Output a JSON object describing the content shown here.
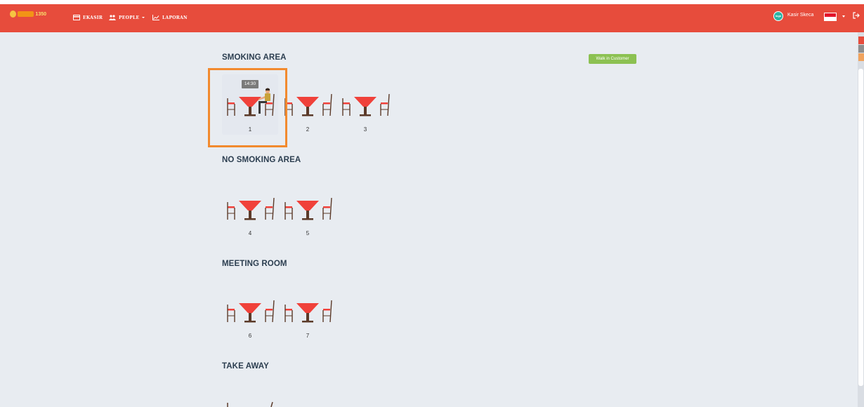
{
  "navbar": {
    "brand": "1350",
    "items": [
      {
        "label": "EKASIR",
        "icon": "credit-card-icon"
      },
      {
        "label": "PEOPLE",
        "icon": "people-icon"
      },
      {
        "label": "LAPORAN",
        "icon": "line-chart-icon"
      }
    ],
    "user": {
      "name": "Kasir Skeca",
      "avatar_text": "logo"
    }
  },
  "walkin_button": "Walk in Customer",
  "sections": [
    {
      "title": "SMOKING AREA"
    },
    {
      "title": "NO SMOKING AREA"
    },
    {
      "title": "MEETING ROOM"
    },
    {
      "title": "TAKE AWAY"
    }
  ],
  "tables": [
    {
      "number": "1",
      "occupied": true,
      "time": "14:30"
    },
    {
      "number": "2"
    },
    {
      "number": "3"
    },
    {
      "number": "4"
    },
    {
      "number": "5"
    },
    {
      "number": "6"
    },
    {
      "number": "7"
    }
  ],
  "colors": {
    "navbar": "#e74c3c",
    "background": "#e8ecf1",
    "table_top": "#f0413a",
    "table_base": "#5b3a29",
    "walkin": "#8cc152",
    "highlight": "#f28a2e"
  }
}
